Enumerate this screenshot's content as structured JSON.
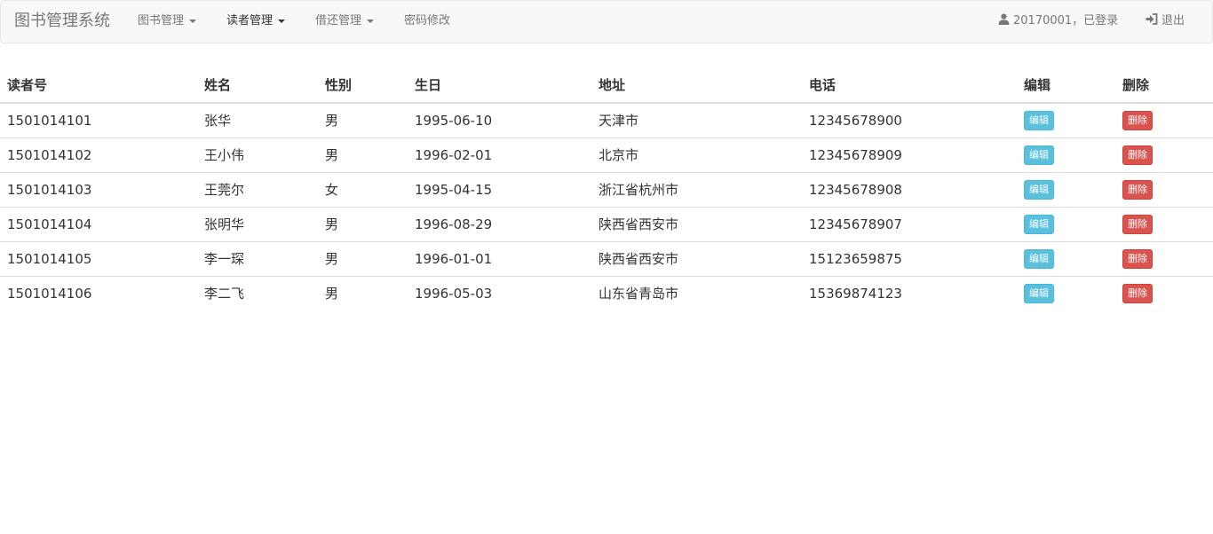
{
  "navbar": {
    "brand": "图书管理系统",
    "menus": [
      {
        "label": "图书管理",
        "dropdown": true,
        "active": false
      },
      {
        "label": "读者管理",
        "dropdown": true,
        "active": true
      },
      {
        "label": "借还管理",
        "dropdown": true,
        "active": false
      },
      {
        "label": "密码修改",
        "dropdown": false,
        "active": false
      }
    ],
    "user_status": "20170001，已登录",
    "user_icon": "user-icon",
    "logout_label": "退出",
    "logout_icon": "log-in-icon"
  },
  "colors": {
    "edit_button": "#5bc0de",
    "delete_button": "#d9534f",
    "navbar_bg": "#f8f8f8"
  },
  "table": {
    "headers": [
      "读者号",
      "姓名",
      "性别",
      "生日",
      "地址",
      "电话",
      "编辑",
      "删除"
    ],
    "edit_label": "编辑",
    "delete_label": "删除",
    "rows": [
      {
        "id": "1501014101",
        "name": "张华",
        "sex": "男",
        "birthday": "1995-06-10",
        "address": "天津市",
        "phone": "12345678900"
      },
      {
        "id": "1501014102",
        "name": "王小伟",
        "sex": "男",
        "birthday": "1996-02-01",
        "address": "北京市",
        "phone": "12345678909"
      },
      {
        "id": "1501014103",
        "name": "王莞尔",
        "sex": "女",
        "birthday": "1995-04-15",
        "address": "浙江省杭州市",
        "phone": "12345678908"
      },
      {
        "id": "1501014104",
        "name": "张明华",
        "sex": "男",
        "birthday": "1996-08-29",
        "address": "陕西省西安市",
        "phone": "12345678907"
      },
      {
        "id": "1501014105",
        "name": "李一琛",
        "sex": "男",
        "birthday": "1996-01-01",
        "address": "陕西省西安市",
        "phone": "15123659875"
      },
      {
        "id": "1501014106",
        "name": "李二飞",
        "sex": "男",
        "birthday": "1996-05-03",
        "address": "山东省青岛市",
        "phone": "15369874123"
      }
    ]
  }
}
